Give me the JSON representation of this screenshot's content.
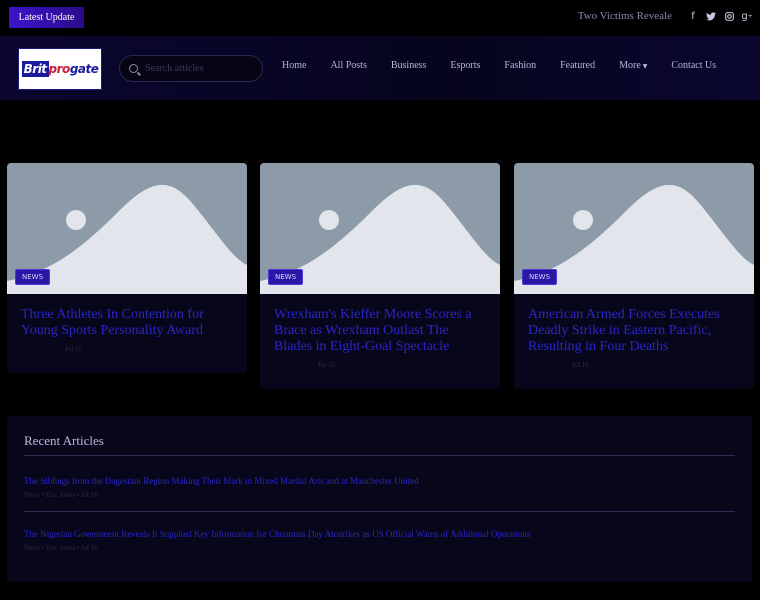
{
  "topbar": {
    "latest_label": "Latest Update",
    "ticker": "Two Victims Reveale",
    "socials": [
      "facebook-icon",
      "twitter-icon",
      "instagram-icon",
      "google-plus-icon"
    ]
  },
  "header": {
    "logo": {
      "part1": "Brit",
      "part2": "pro",
      "part3": "gate"
    },
    "search": {
      "placeholder": "Search articles"
    },
    "nav": [
      "Home",
      "All Posts",
      "Business",
      "Esports",
      "Fashion",
      "Featured",
      "More",
      "Contact Us"
    ]
  },
  "cards": [
    {
      "badge": "NEWS",
      "title": "Three Athletes In Contention for Young Sports Personality Award",
      "meta": "Jul 16"
    },
    {
      "badge": "NEWS",
      "title": "Wrexham's Kieffer Moore Scores a Brace as Wrexham Outlast The Blades in Eight-Goal Spectacle",
      "meta": "Jul 16"
    },
    {
      "badge": "NEWS",
      "title": "American Armed Forces Executes Deadly Strike in Eastern Pacific, Resulting in Four Deaths",
      "meta": "Jul 16"
    }
  ],
  "recent": {
    "heading": "Recent Articles",
    "items": [
      {
        "title": "The Siblings from the Dagestani Region Making Their Mark in Mixed Martial Arts and at Manchester United",
        "meta": "News • Eric Jones • Jul 16"
      },
      {
        "title": "The Nigerian Government Reveals It Supplied Key Information for Christmas Day Airstrikes as US Official Warns of Additional Operations",
        "meta": "News • Eric Jones • Jul 16"
      }
    ]
  },
  "colors": {
    "accent": "#2b17a6",
    "link": "#2a26c8",
    "background": "#000000",
    "panel": "#07061a",
    "placeholder_image": "#8d9aa8"
  }
}
